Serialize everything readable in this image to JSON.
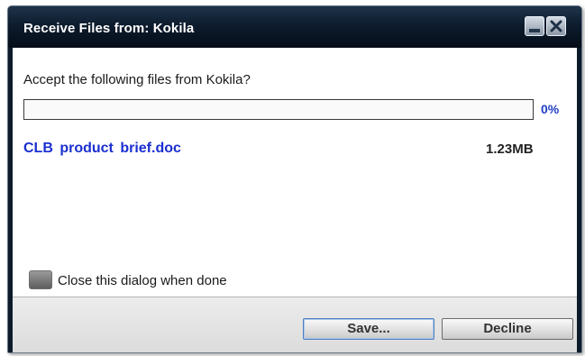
{
  "window": {
    "title": "Receive Files from: Kokila"
  },
  "titlebar_buttons": {
    "minimize_icon": "minimize-icon",
    "close_icon": "close-x-icon"
  },
  "dialog": {
    "prompt": "Accept the following files from Kokila?",
    "progress": {
      "percent_label": "0%",
      "fraction": 0
    },
    "file": {
      "name": "CLB  product  brief.doc",
      "size": "1.23MB"
    },
    "close_when_done": {
      "label": "Close this dialog when done",
      "checked": false
    }
  },
  "buttons": {
    "save_label": "Save...",
    "decline_label": "Decline"
  },
  "colors": {
    "titlebar": "#0d1c2e",
    "link_blue": "#1a2fd0",
    "percent_blue": "#2240c8"
  }
}
